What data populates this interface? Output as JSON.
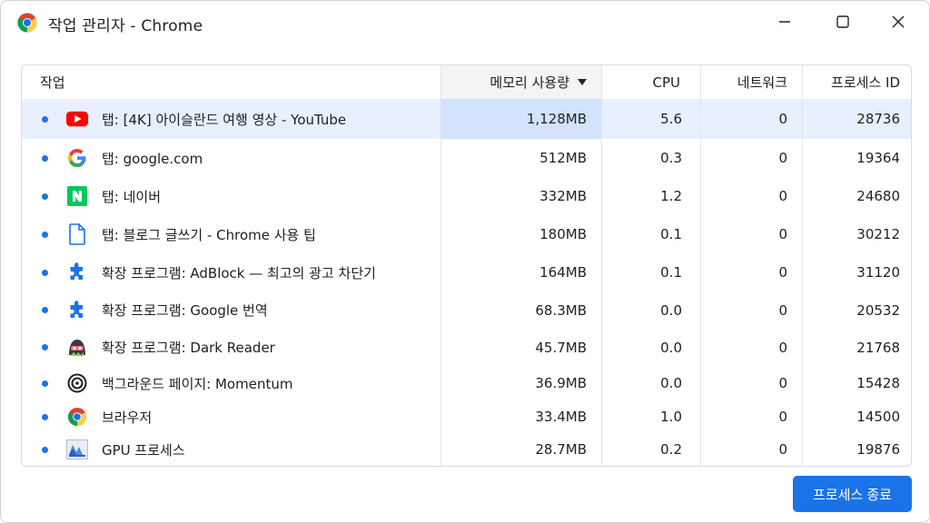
{
  "window": {
    "title": "작업 관리자 - Chrome"
  },
  "table": {
    "columns": {
      "task": "작업",
      "memory": "메모리 사용량",
      "cpu": "CPU",
      "network": "네트워크",
      "pid": "프로세스 ID"
    },
    "sort": {
      "column": "memory",
      "direction": "descending"
    },
    "rows": [
      {
        "icon": "youtube-icon",
        "task": "탭: [4K] 아이슬란드 여행 영상 - YouTube",
        "memory": "1,128MB",
        "cpu": "5.6",
        "network": "0",
        "pid": "28736",
        "selected": true
      },
      {
        "icon": "google-icon",
        "task": "탭: google.com",
        "memory": "512MB",
        "cpu": "0.3",
        "network": "0",
        "pid": "19364",
        "selected": false
      },
      {
        "icon": "naver-icon",
        "task": "탭: 네이버",
        "memory": "332MB",
        "cpu": "1.2",
        "network": "0",
        "pid": "24680",
        "selected": false
      },
      {
        "icon": "document-icon",
        "task": "탭: 블로그 글쓰기 - Chrome 사용 팁",
        "memory": "180MB",
        "cpu": "0.1",
        "network": "0",
        "pid": "30212",
        "selected": false
      },
      {
        "icon": "puzzle-icon",
        "task": "확장 프로그램: AdBlock — 최고의 광고 차단기",
        "memory": "164MB",
        "cpu": "0.1",
        "network": "0",
        "pid": "31120",
        "selected": false
      },
      {
        "icon": "puzzle-icon",
        "task": "확장 프로그램: Google 번역",
        "memory": "68.3MB",
        "cpu": "0.0",
        "network": "0",
        "pid": "20532",
        "selected": false
      },
      {
        "icon": "dark-reader-icon",
        "task": "확장 프로그램: Dark Reader",
        "memory": "45.7MB",
        "cpu": "0.0",
        "network": "0",
        "pid": "21768",
        "selected": false
      },
      {
        "icon": "momentum-icon",
        "task": "백그라운드 페이지: Momentum",
        "memory": "36.9MB",
        "cpu": "0.0",
        "network": "0",
        "pid": "15428",
        "selected": false
      },
      {
        "icon": "chrome-icon",
        "task": "브라우저",
        "memory": "33.4MB",
        "cpu": "1.0",
        "network": "0",
        "pid": "14500",
        "selected": false
      },
      {
        "icon": "gpu-icon",
        "task": "GPU 프로세스",
        "memory": "28.7MB",
        "cpu": "0.2",
        "network": "0",
        "pid": "19876",
        "selected": false
      }
    ]
  },
  "footer": {
    "end_process_label": "프로세스 종료"
  },
  "colors": {
    "accent": "#1a73e8",
    "selected_row": "#e8f0fe",
    "selected_cell": "#d3e3fd"
  }
}
